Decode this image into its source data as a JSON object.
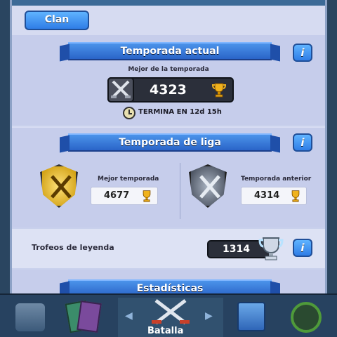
{
  "clan_button": "Clan",
  "current_season": {
    "title": "Temporada actual",
    "best_label": "Mejor de la temporada",
    "best_value": "4323",
    "ends_text": "TERMINA EN 12d 15h"
  },
  "league_season": {
    "title": "Temporada de liga",
    "best_label": "Mejor temporada",
    "best_value": "4677",
    "previous_label": "Temporada anterior",
    "previous_value": "4314"
  },
  "legend_trophies": {
    "label": "Trofeos de leyenda",
    "value": "1314"
  },
  "stats_title": "Estadísticas",
  "info_symbol": "i",
  "nav": {
    "battle_label": "Batalla",
    "left_arrow": "◀",
    "right_arrow": "▶"
  },
  "colors": {
    "ribbon_blue": "#2f72d8",
    "panel": "#c6cdeb",
    "trophy_gold": "#f0b21d",
    "trophy_silver": "#cfd8e6"
  }
}
